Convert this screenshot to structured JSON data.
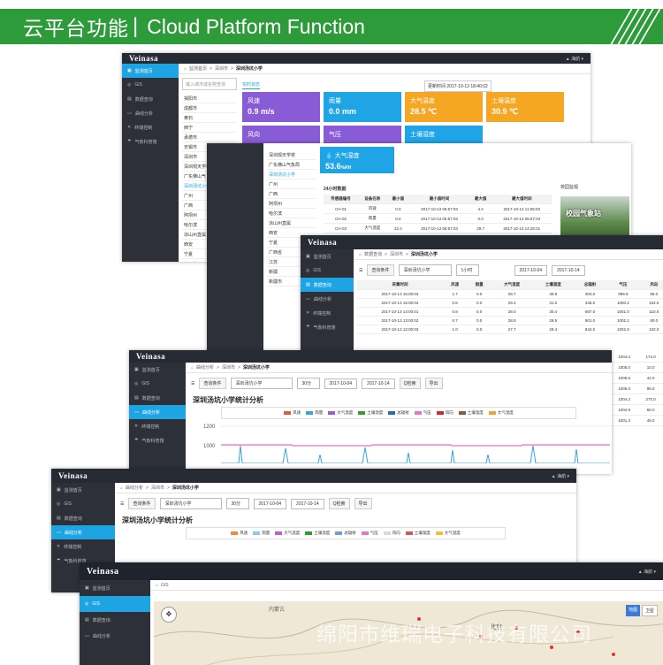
{
  "banner": {
    "cn_title": "云平台功能",
    "en_title": "Cloud Platform Function"
  },
  "brand": "Veinasa",
  "user_label": "▲ 海航 ▾",
  "w1": {
    "nav": [
      "监测首页",
      "GIS",
      "数据查询",
      "曲线分析",
      "终端控制",
      "气象科普馆"
    ],
    "crumb": [
      "监测首页",
      "深圳市",
      "深圳汤坑小学"
    ],
    "search_placeholder": "输入城市或名称查询",
    "tab": "实时状态",
    "update_time": "更新时间 2017-10-13 18:40:02",
    "cities": [
      "揭阳市",
      "成都市",
      "黄石",
      "西宁",
      "承德市",
      "无锡市",
      "深圳市",
      "深圳观天学校",
      "广东佛山气",
      "深圳汤坑小学",
      "广州",
      "广西",
      "阿坝州",
      "哈尔滨",
      "凉山州直属",
      "西安",
      "宁夏",
      "广西省",
      "江苏"
    ],
    "tiles": [
      {
        "label": "风速",
        "value": "0.9",
        "unit": "m/s",
        "color": "#8a5bd6"
      },
      {
        "label": "雨量",
        "value": "0.0",
        "unit": "mm",
        "color": "#1fa4e6"
      },
      {
        "label": "大气温度",
        "value": "28.5",
        "unit": "℃",
        "color": "#f5a623"
      },
      {
        "label": "土壤温度",
        "value": "30.9",
        "unit": "℃",
        "color": "#f5a623"
      }
    ],
    "tiles_row2": [
      "风向",
      "气压",
      "土壤湿度"
    ]
  },
  "w2": {
    "cities": [
      "深圳观天学校",
      "广东佛山气象局",
      "深圳汤坑小学",
      "广州",
      "广西",
      "阿坝州",
      "哈尔滨",
      "凉山州直属",
      "西安",
      "宁夏",
      "广西省",
      "江苏",
      "新疆",
      "新疆市"
    ],
    "tile": {
      "label": "大气湿度",
      "value": "53.6",
      "unit": "%RH",
      "color": "#1fa4e6"
    },
    "table_title": "24小时数据",
    "side_title": "校园监视",
    "photo_text": "校园气象站",
    "headers": [
      "传感器编号",
      "设备名称",
      "最小值",
      "最小值时间",
      "最大值",
      "最大值时间"
    ],
    "rows": [
      [
        "CH-01",
        "风速",
        "0.0",
        "2017-10-13 06:57:03",
        "4.4",
        "2017-10-13 11:06:03"
      ],
      [
        "CH-02",
        "雨量",
        "0.0",
        "2017-10-13 06:57:03",
        "0.0",
        "2017-10-13 06:57:03"
      ],
      [
        "CH-03",
        "大气温度",
        "22.4",
        "2017-10-13 06:57:03",
        "29.7",
        "2017-10-13 14:25:01"
      ]
    ]
  },
  "w3": {
    "nav": [
      "监测首页",
      "GIS",
      "数据查询",
      "曲线分析",
      "终端控制",
      "气象科普馆"
    ],
    "crumb": [
      "数据查询",
      "深圳市",
      "深圳汤坑小学"
    ],
    "btn": "查询条件",
    "site": "深圳汤坑小学",
    "interval": "1小时",
    "date_from": "2017-10-04",
    "date_to": "2017-10-14",
    "headers": [
      "采集时间",
      "风速",
      "雨量",
      "大气温度",
      "土壤温度",
      "总辐射",
      "气压",
      "风向"
    ],
    "rows": [
      [
        "2017-10-13 16:00:03",
        "1.7",
        "0.0",
        "28.7",
        "30.9",
        "304.0",
        "999.9",
        "58.0"
      ],
      [
        "2017-10-13 15:00:04",
        "0.8",
        "0.0",
        "29.4",
        "31.0",
        "345.0",
        "1000.2",
        "154.0"
      ],
      [
        "2017-10-13 14:00:01",
        "0.8",
        "0.0",
        "28.0",
        "30.4",
        "687.0",
        "1001.0",
        "110.0"
      ],
      [
        "2017-10-13 13:00:02",
        "0.7",
        "0.0",
        "28.8",
        "29.5",
        "901.0",
        "1002.1",
        "80.0"
      ],
      [
        "2017-10-13 12:00:03",
        "1.0",
        "0.0",
        "27.7",
        "28.4",
        "842.0",
        "1002.9",
        "102.0"
      ]
    ],
    "extra_rows": [
      [
        "1004.2",
        "174.0"
      ],
      [
        "1005.0",
        "10.0"
      ],
      [
        "1005.6",
        "42.0"
      ],
      [
        "1006.0",
        "95.0"
      ],
      [
        "1004.2",
        "270.0"
      ],
      [
        "1004.9",
        "65.0"
      ],
      [
        "1001.3",
        "45.0"
      ]
    ]
  },
  "w4": {
    "nav": [
      "监测首页",
      "GIS",
      "数据查询",
      "曲线分析",
      "终端控制",
      "气象科普馆"
    ],
    "crumb": [
      "曲线分析",
      "深圳市",
      "深圳汤坑小学"
    ],
    "btn": "查询条件",
    "site": "深圳汤坑小学",
    "interval": "30分",
    "date_from": "2017-10-04",
    "date_to": "2017-10-14",
    "search": "Q检索",
    "export": "导出",
    "chart_title": "深圳汤坑小学统计分析",
    "legend": [
      {
        "name": "风速",
        "color": "#e8553c"
      },
      {
        "name": "雨量",
        "color": "#3aa3e3"
      },
      {
        "name": "大气温度",
        "color": "#9b59d0"
      },
      {
        "name": "土壤湿度",
        "color": "#2ca02c"
      },
      {
        "name": "总辐射",
        "color": "#1f6fb4"
      },
      {
        "name": "气压",
        "color": "#e377c2"
      },
      {
        "name": "风向",
        "color": "#d62728"
      },
      {
        "name": "土壤温度",
        "color": "#8c564b"
      },
      {
        "name": "大气湿度",
        "color": "#f0a030"
      }
    ],
    "y_ticks": [
      "1200",
      "1000"
    ]
  },
  "w5": {
    "nav": [
      "监测首页",
      "GIS",
      "数据查询",
      "曲线分析",
      "终端控制",
      "气象科普馆"
    ],
    "crumb": [
      "曲线分析",
      "深圳市",
      "深圳汤坑小学"
    ],
    "btn": "查询条件",
    "site": "深圳汤坑小学",
    "interval": "30分",
    "date_from": "2017-10-04",
    "date_to": "2017-10-14",
    "search": "Q检索",
    "export": "导出",
    "chart_title": "深圳汤坑小学统计分析",
    "legend": [
      {
        "name": "风速",
        "color": "#f08a3a"
      },
      {
        "name": "雨量",
        "color": "#8cc8f0"
      },
      {
        "name": "大气温度",
        "color": "#c060c0"
      },
      {
        "name": "土壤湿度",
        "color": "#2ca02c"
      },
      {
        "name": "总辐射",
        "color": "#6aa0d8"
      },
      {
        "name": "气压",
        "color": "#e377c2"
      },
      {
        "name": "风向",
        "color": "#d9d9d9"
      },
      {
        "name": "土壤温度",
        "color": "#e05050"
      },
      {
        "name": "大气湿度",
        "color": "#f0c040"
      }
    ]
  },
  "w6": {
    "nav": [
      "监测首页",
      "GIS",
      "数据查询",
      "曲线分析"
    ],
    "crumb": "GIS",
    "map_labels": [
      "北京",
      "内蒙古"
    ],
    "map_btns": [
      "地图",
      "卫星"
    ]
  },
  "watermark": "绵阳市维瑞电子科技有限公司"
}
